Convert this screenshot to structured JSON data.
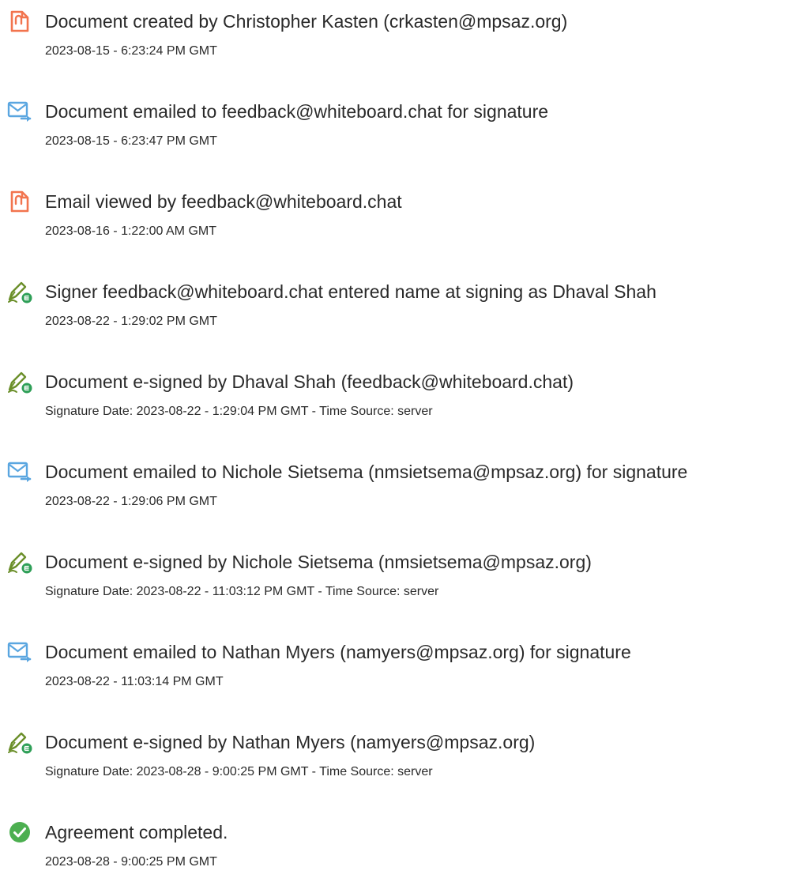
{
  "events": [
    {
      "type": "created",
      "icon": "document-created-icon",
      "title": "Document created by Christopher Kasten (crkasten@mpsaz.org)",
      "time": "2023-08-15 - 6:23:24 PM GMT"
    },
    {
      "type": "emailed",
      "icon": "email-sent-icon",
      "title": "Document emailed to feedback@whiteboard.chat for signature",
      "time": "2023-08-15 - 6:23:47 PM GMT"
    },
    {
      "type": "viewed",
      "icon": "document-viewed-icon",
      "title": "Email viewed by feedback@whiteboard.chat",
      "time": "2023-08-16 - 1:22:00 AM GMT"
    },
    {
      "type": "signed",
      "icon": "e-sign-pen-icon",
      "title": "Signer feedback@whiteboard.chat entered name at signing as Dhaval Shah",
      "time": "2023-08-22 - 1:29:02 PM GMT"
    },
    {
      "type": "signed",
      "icon": "e-sign-pen-icon",
      "title": "Document e-signed by Dhaval Shah (feedback@whiteboard.chat)",
      "time": "Signature Date: 2023-08-22 - 1:29:04 PM GMT - Time Source: server"
    },
    {
      "type": "emailed",
      "icon": "email-sent-icon",
      "title": "Document emailed to Nichole Sietsema (nmsietsema@mpsaz.org) for signature",
      "time": "2023-08-22 - 1:29:06 PM GMT"
    },
    {
      "type": "signed",
      "icon": "e-sign-pen-icon",
      "title": "Document e-signed by Nichole Sietsema (nmsietsema@mpsaz.org)",
      "time": "Signature Date: 2023-08-22 - 11:03:12 PM GMT - Time Source: server"
    },
    {
      "type": "emailed",
      "icon": "email-sent-icon",
      "title": "Document emailed to Nathan Myers (namyers@mpsaz.org) for signature",
      "time": "2023-08-22 - 11:03:14 PM GMT"
    },
    {
      "type": "signed",
      "icon": "e-sign-pen-icon",
      "title": "Document e-signed by Nathan Myers (namyers@mpsaz.org)",
      "time": "Signature Date: 2023-08-28 - 9:00:25 PM GMT - Time Source: server"
    },
    {
      "type": "completed",
      "icon": "checkmark-circle-icon",
      "title": "Agreement completed.",
      "time": "2023-08-28 - 9:00:25 PM GMT"
    }
  ],
  "colors": {
    "document_icon": "#f2744e",
    "email_icon": "#5aa6e0",
    "pen_icon": "#6b8f2a",
    "badge_green": "#2e9f57",
    "check_green": "#4caf50"
  }
}
